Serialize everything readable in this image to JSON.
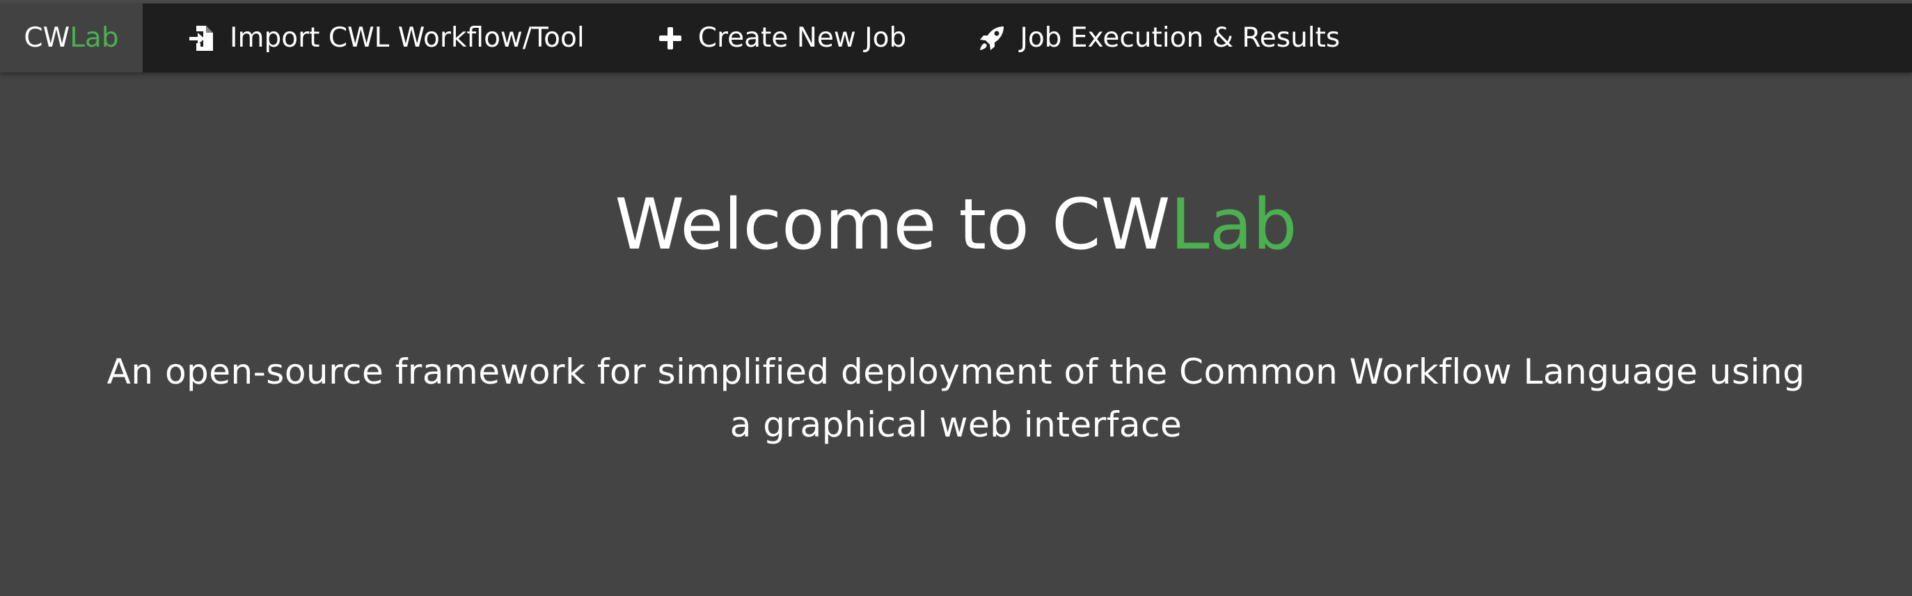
{
  "navbar": {
    "brand": {
      "part1": "CW",
      "part2": "Lab"
    },
    "items": [
      {
        "label": "Import CWL Workflow/Tool",
        "icon": "file-import-icon"
      },
      {
        "label": "Create New Job",
        "icon": "plus-icon"
      },
      {
        "label": "Job Execution & Results",
        "icon": "rocket-icon"
      }
    ]
  },
  "hero": {
    "title_prefix": "Welcome to ",
    "title_part1": "CW",
    "title_part2": "Lab",
    "subtitle": "An open-source framework for simplified deployment of the Common Workflow Language using a graphical web interface"
  },
  "colors": {
    "navbar_bg": "#1e1e1e",
    "brand_bg": "#424242",
    "page_bg": "#444444",
    "accent_green": "#4caf50",
    "text": "#ffffff"
  }
}
